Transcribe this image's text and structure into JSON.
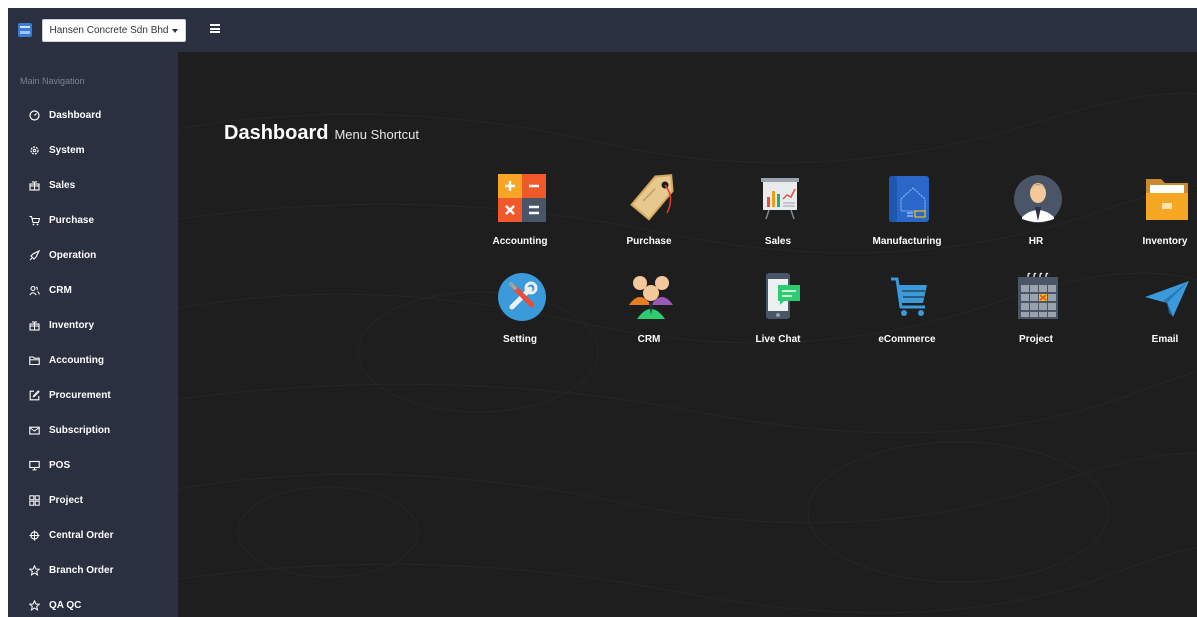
{
  "header": {
    "company": "Hansen Concrete Sdn Bhd"
  },
  "sidebar": {
    "header": "Main Navigation",
    "items": [
      {
        "label": "Dashboard",
        "icon": "dashboard-icon"
      },
      {
        "label": "System",
        "icon": "gear-icon"
      },
      {
        "label": "Sales",
        "icon": "gift-icon"
      },
      {
        "label": "Purchase",
        "icon": "cart-icon"
      },
      {
        "label": "Operation",
        "icon": "rocket-icon"
      },
      {
        "label": "CRM",
        "icon": "users-icon"
      },
      {
        "label": "Inventory",
        "icon": "gift-icon"
      },
      {
        "label": "Accounting",
        "icon": "folder-icon"
      },
      {
        "label": "Procurement",
        "icon": "edit-icon"
      },
      {
        "label": "Subscription",
        "icon": "mail-icon"
      },
      {
        "label": "POS",
        "icon": "monitor-icon"
      },
      {
        "label": "Project",
        "icon": "grid-icon"
      },
      {
        "label": "Central Order",
        "icon": "crosshair-icon"
      },
      {
        "label": "Branch Order",
        "icon": "star-icon"
      },
      {
        "label": "QA QC",
        "icon": "star-icon"
      }
    ]
  },
  "main": {
    "title": "Dashboard",
    "subtitle": "Menu Shortcut",
    "shortcuts": [
      {
        "label": "Accounting",
        "icon": "calculator-icon"
      },
      {
        "label": "Purchase",
        "icon": "price-tag-icon"
      },
      {
        "label": "Sales",
        "icon": "presentation-chart-icon"
      },
      {
        "label": "Manufacturing",
        "icon": "blueprint-icon"
      },
      {
        "label": "HR",
        "icon": "person-icon"
      },
      {
        "label": "Inventory",
        "icon": "folder-icon"
      },
      {
        "label": "Setting",
        "icon": "tools-icon"
      },
      {
        "label": "CRM",
        "icon": "people-icon"
      },
      {
        "label": "Live Chat",
        "icon": "chat-phone-icon"
      },
      {
        "label": "eCommerce",
        "icon": "shopping-cart-icon"
      },
      {
        "label": "Project",
        "icon": "calendar-icon"
      },
      {
        "label": "Email",
        "icon": "paper-plane-icon"
      }
    ]
  }
}
